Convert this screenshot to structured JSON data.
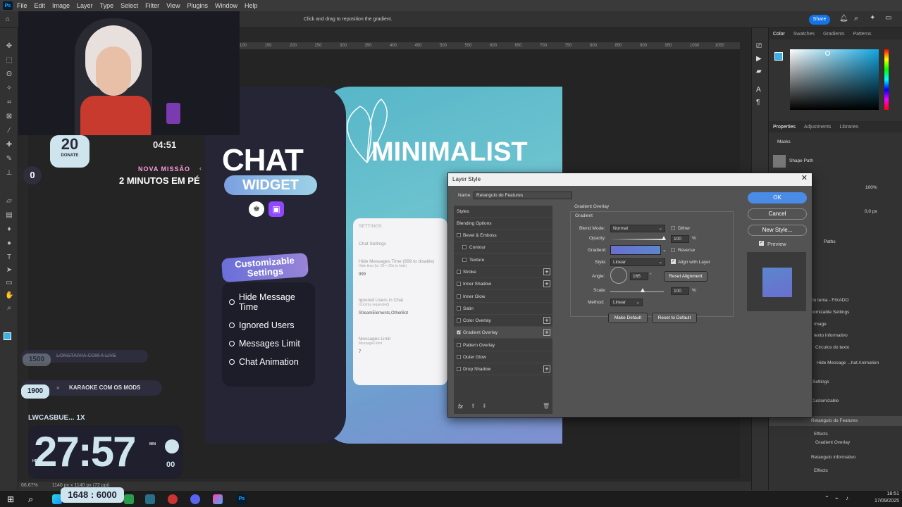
{
  "menubar": {
    "app_icon": "Ps",
    "items": [
      "File",
      "Edit",
      "Image",
      "Layer",
      "Type",
      "Select",
      "Filter",
      "View",
      "Plugins",
      "Window",
      "Help"
    ]
  },
  "options_bar": {
    "hint": "Click and drag to reposition the gradient.",
    "share_label": "Share"
  },
  "ruler": {
    "ticks": [
      "100",
      "150",
      "200",
      "250",
      "300",
      "350",
      "400",
      "450",
      "500",
      "550",
      "600",
      "650",
      "700",
      "750",
      "800",
      "850",
      "900",
      "950",
      "1000",
      "1050"
    ]
  },
  "stream_overlay": {
    "donate_value": "20",
    "donate_label": "DONATE",
    "small_timer": "04:51",
    "counter": "0",
    "mission_label": "NOVA MISSÃO",
    "mission_text": "2 MINUTOS EM PÉ",
    "goal_value": "1500",
    "goal_text": "LONGTAIVIA COM A LIVE",
    "karaoke_value": "1900",
    "karaoke_text": "KARAOKE COM OS MODS",
    "user_label": "LWCASBUE... 1X",
    "big_timer": "27:57",
    "timer_unit_hrs": "HRS",
    "timer_unit_min": "MIN",
    "timer_seconds": "00"
  },
  "document": {
    "chat_title": "CHAT",
    "widget_label": "WIDGET",
    "minimalist_title": "MINIMALIST",
    "customizable_label": "Customizable Settings",
    "features": [
      "Hide Message Time",
      "Ignored Users",
      "Messages Limit",
      "Chat Animation"
    ],
    "settings_card": {
      "header": "SETTINGS",
      "section": "Chat Settings",
      "field1_label": "Hide Messages Time (999 to disable)",
      "field1_hint": "Hide time (ie: 20 = 20s to hide)",
      "field1_value": "999",
      "field2_label": "Ignored Users in Chat",
      "field2_hint": "(comma separated)",
      "field2_value": "StreamElements,OtherBot",
      "field3_label": "Messages Limit",
      "field3_hint": "Messages limit",
      "field3_value": "7"
    }
  },
  "layer_style": {
    "title": "Layer Style",
    "name_label": "Name:",
    "name_value": "Retangulo do Features",
    "styles_header": "Styles",
    "blending_options": "Blending Options",
    "items": [
      {
        "label": "Bevel & Emboss",
        "checked": false,
        "plus": false
      },
      {
        "label": "Contour",
        "checked": false,
        "plus": false,
        "indent": true
      },
      {
        "label": "Texture",
        "checked": false,
        "plus": false,
        "indent": true
      },
      {
        "label": "Stroke",
        "checked": false,
        "plus": true
      },
      {
        "label": "Inner Shadow",
        "checked": false,
        "plus": true
      },
      {
        "label": "Inner Glow",
        "checked": false,
        "plus": false
      },
      {
        "label": "Satin",
        "checked": false,
        "plus": false
      },
      {
        "label": "Color Overlay",
        "checked": false,
        "plus": true
      },
      {
        "label": "Gradient Overlay",
        "checked": true,
        "plus": true
      },
      {
        "label": "Pattern Overlay",
        "checked": false,
        "plus": false
      },
      {
        "label": "Outer Glow",
        "checked": false,
        "plus": false
      },
      {
        "label": "Drop Shadow",
        "checked": false,
        "plus": true
      }
    ],
    "fx_label": "fx",
    "section_title": "Gradient Overlay",
    "sub_title": "Gradient",
    "blend_mode_label": "Blend Mode:",
    "blend_mode_value": "Normal",
    "dither_label": "Dither",
    "opacity_label": "Opacity:",
    "opacity_value": "100",
    "opacity_level": 1.0,
    "percent": "%",
    "gradient_label": "Gradient:",
    "gradient_colors": [
      "#6a6fd0",
      "#5c86cc"
    ],
    "reverse_label": "Reverse",
    "style_label": "Style:",
    "style_value": "Linear",
    "align_label": "Align with Layer",
    "angle_label": "Angle:",
    "angle_value": "165",
    "degree": "°",
    "reset_alignment": "Reset Alignment",
    "scale_label": "Scale:",
    "scale_value": "100",
    "scale_level": 0.6,
    "method_label": "Method:",
    "method_value": "Linear",
    "make_default": "Make Default",
    "reset_default": "Reset to Default",
    "ok": "OK",
    "cancel": "Cancel",
    "new_style": "New Style...",
    "preview_label": "Preview"
  },
  "right_panel": {
    "color_tabs": [
      "Color",
      "Swatches",
      "Gradients",
      "Patterns"
    ],
    "prop_tabs": [
      "Properties",
      "Adjustments",
      "Libraries"
    ],
    "masks_label": "Masks",
    "shape_path": "Shape Path",
    "opacity_value": "100%",
    "px_value": "0,0 px",
    "paths_tab": "Paths",
    "layers": [
      "do tema - FIXADO",
      "stomizable Settings",
      "image",
      "texto informativo",
      "Circulos do texto",
      "Hide Message ...hat Animation",
      "Settings",
      "Customizable",
      "Retangulo do Features",
      "Effects",
      "Gradient Overlay",
      "Retangulo informativo",
      "Effects"
    ]
  },
  "status_bar": {
    "zoom": "66,67%",
    "doc_size": "1140 px x 1140 px (72 ppi)"
  },
  "taskbar": {
    "stats": "1648 : 6000",
    "time": "18:51",
    "date": "17/09/2025"
  }
}
